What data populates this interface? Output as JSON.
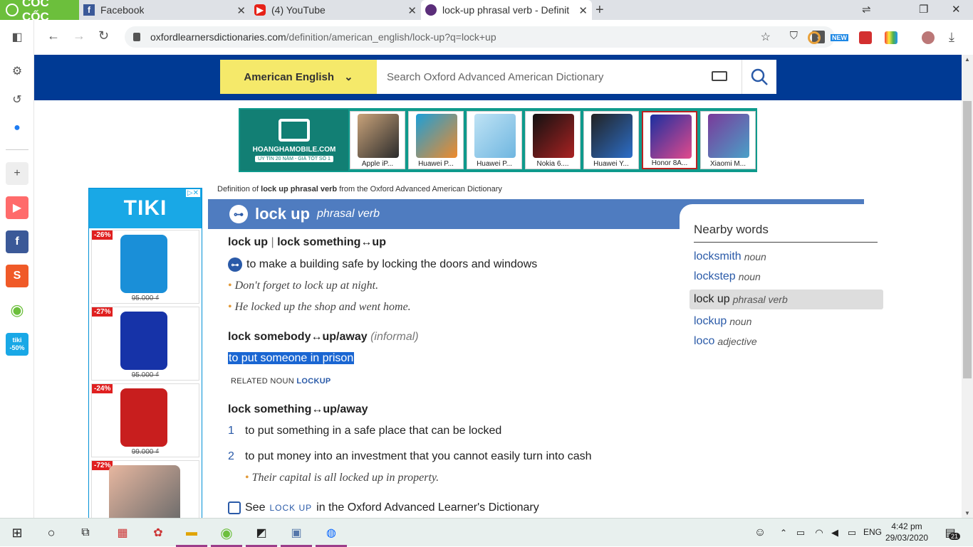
{
  "browser": {
    "brand": "CỐC CỐC",
    "tabs": [
      {
        "title": "Facebook",
        "icon": "facebook-icon"
      },
      {
        "title": "(4) YouTube",
        "icon": "youtube-icon"
      },
      {
        "title": "lock-up phrasal verb - Definit",
        "icon": "oxford-icon",
        "active": true
      }
    ],
    "url_domain": "oxfordlearnersdictionaries.com",
    "url_path": "/definition/american_english/lock-up?q=lock+up",
    "toolbar_badge": "NEW"
  },
  "sidebar": {
    "tiki_badge_top": "tiki",
    "tiki_badge_bottom": "-50%"
  },
  "site": {
    "language": "American English",
    "search_placeholder": "Search Oxford Advanced American Dictionary"
  },
  "banner_ad": {
    "site": "HOANGHAMOBILE.COM",
    "tagline": "UY TÍN 20 NĂM - GIÁ TỐT SỐ 1",
    "products": [
      "Apple iP...",
      "Huawei P...",
      "Huawei P...",
      "Nokia 6....",
      "Huawei Y...",
      "Honor 8A...",
      "Xiaomi M..."
    ]
  },
  "tiki_ad": {
    "brand": "TIKI",
    "products": [
      {
        "discount": "-26%",
        "price": "95.000 ₫"
      },
      {
        "discount": "-27%",
        "price": "95.000 ₫"
      },
      {
        "discount": "-24%",
        "price": "99.000 ₫"
      },
      {
        "discount": "-72%",
        "price": ""
      }
    ]
  },
  "entry": {
    "crumb_prefix": "Definition of",
    "crumb_word": "lock up phrasal verb",
    "crumb_suffix": "from the Oxford Advanced American Dictionary",
    "headword": "lock up",
    "pos": "phrasal verb",
    "sense1_head_a": "lock up",
    "sense1_sep": "|",
    "sense1_head_b": "lock something↔up",
    "sense1_def": "to make a building safe by locking the doors and windows",
    "sense1_ex1": "Don't forget to lock up at night.",
    "sense1_ex2": "He locked up the shop and went home.",
    "sense2_head": "lock somebody↔up/away",
    "sense2_label": "(informal)",
    "sense2_def": "to put someone in prison",
    "related_label": "RELATED NOUN",
    "related_word": "LOCKUP",
    "sense3_head": "lock something↔up/away",
    "sub1_num": "1",
    "sub1_def": "to put something in a safe place that can be locked",
    "sub2_num": "2",
    "sub2_def": "to put money into an investment that you cannot easily turn into cash",
    "sub2_ex": "Their capital is all locked up in property.",
    "see_prefix": "See",
    "see_word": "LOCK UP",
    "see_suffix": "in the Oxford Advanced Learner's Dictionary"
  },
  "nearby": {
    "title": "Nearby words",
    "items": [
      {
        "word": "locksmith",
        "pos": "noun"
      },
      {
        "word": "lockstep",
        "pos": "noun"
      },
      {
        "word": "lock up",
        "pos": "phrasal verb",
        "selected": true
      },
      {
        "word": "lockup",
        "pos": "noun"
      },
      {
        "word": "loco",
        "pos": "adjective"
      }
    ]
  },
  "taskbar": {
    "language": "ENG",
    "time": "4:42 pm",
    "date": "29/03/2020",
    "notifications": "21"
  },
  "colors": {
    "header_blue": "#003a94",
    "title_blue": "#4f7cc0",
    "lang_yellow": "#f5e96a",
    "link_blue": "#2a5aa8",
    "selection_blue": "#1a66d2",
    "coccoc_green": "#6cbf3c"
  }
}
